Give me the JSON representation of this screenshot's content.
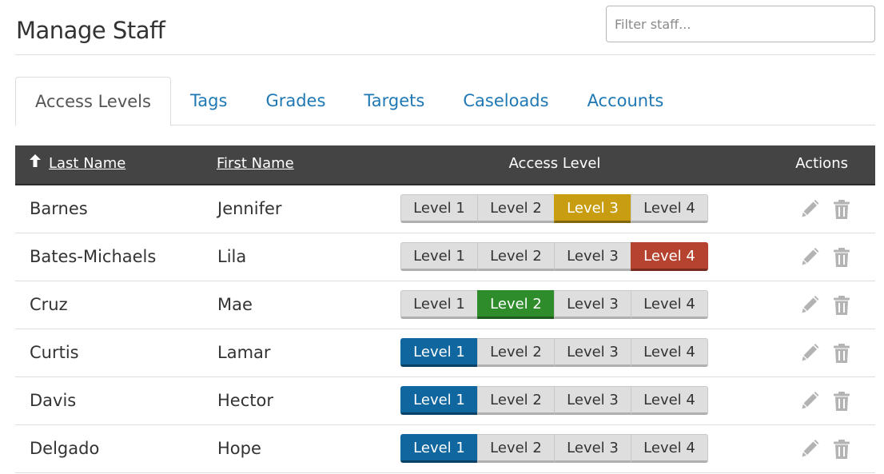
{
  "header": {
    "title": "Manage Staff",
    "filter_placeholder": "Filter staff..."
  },
  "tabs": [
    {
      "label": "Access Levels",
      "active": true
    },
    {
      "label": "Tags",
      "active": false
    },
    {
      "label": "Grades",
      "active": false
    },
    {
      "label": "Targets",
      "active": false
    },
    {
      "label": "Caseloads",
      "active": false
    },
    {
      "label": "Accounts",
      "active": false
    }
  ],
  "table": {
    "columns": {
      "last_name": "Last Name",
      "first_name": "First Name",
      "access_level": "Access Level",
      "actions": "Actions"
    },
    "sort_icon": "arrow-up-icon",
    "level_labels": [
      "Level 1",
      "Level 2",
      "Level 3",
      "Level 4"
    ],
    "level_colors": [
      "#10669e",
      "#2e8c2a",
      "#c89d12",
      "#b5432f"
    ],
    "rows": [
      {
        "last": "Barnes",
        "first": "Jennifer",
        "level": 3
      },
      {
        "last": "Bates-Michaels",
        "first": "Lila",
        "level": 4
      },
      {
        "last": "Cruz",
        "first": "Mae",
        "level": 2
      },
      {
        "last": "Curtis",
        "first": "Lamar",
        "level": 1
      },
      {
        "last": "Davis",
        "first": "Hector",
        "level": 1
      },
      {
        "last": "Delgado",
        "first": "Hope",
        "level": 1
      }
    ],
    "row_icons": [
      "pencil-icon",
      "trash-icon"
    ]
  }
}
